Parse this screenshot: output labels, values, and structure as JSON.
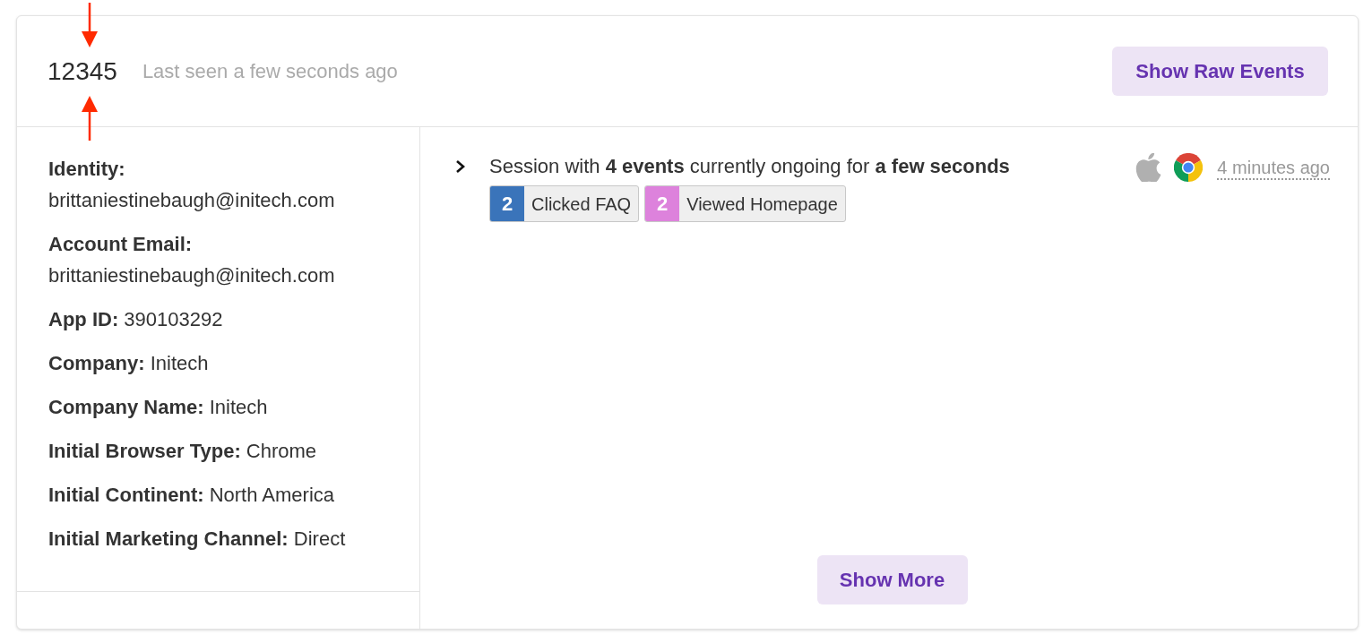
{
  "user": {
    "id": "12345",
    "last_seen": "Last seen a few seconds ago"
  },
  "header_button": "Show Raw Events",
  "properties": [
    {
      "label": "Identity:",
      "value": "brittaniestinebaugh@initech.com"
    },
    {
      "label": "Account Email:",
      "value": "brittaniestinebaugh@initech.com"
    },
    {
      "label": "App ID:",
      "value": "390103292"
    },
    {
      "label": "Company:",
      "value": "Initech"
    },
    {
      "label": "Company Name:",
      "value": "Initech"
    },
    {
      "label": "Initial Browser Type:",
      "value": "Chrome"
    },
    {
      "label": "Initial Continent:",
      "value": "North America"
    },
    {
      "label": "Initial Marketing Channel:",
      "value": "Direct"
    }
  ],
  "session": {
    "expanded": false,
    "summary": "Session with **4 events** currently ongoing for **a few seconds**",
    "time": "4 minutes ago",
    "events": [
      {
        "count": "2",
        "label": "Clicked FAQ",
        "color": "#3a74ba"
      },
      {
        "count": "2",
        "label": "Viewed Homepage",
        "color": "#dd82dc"
      }
    ]
  },
  "show_more_button": "Show More"
}
